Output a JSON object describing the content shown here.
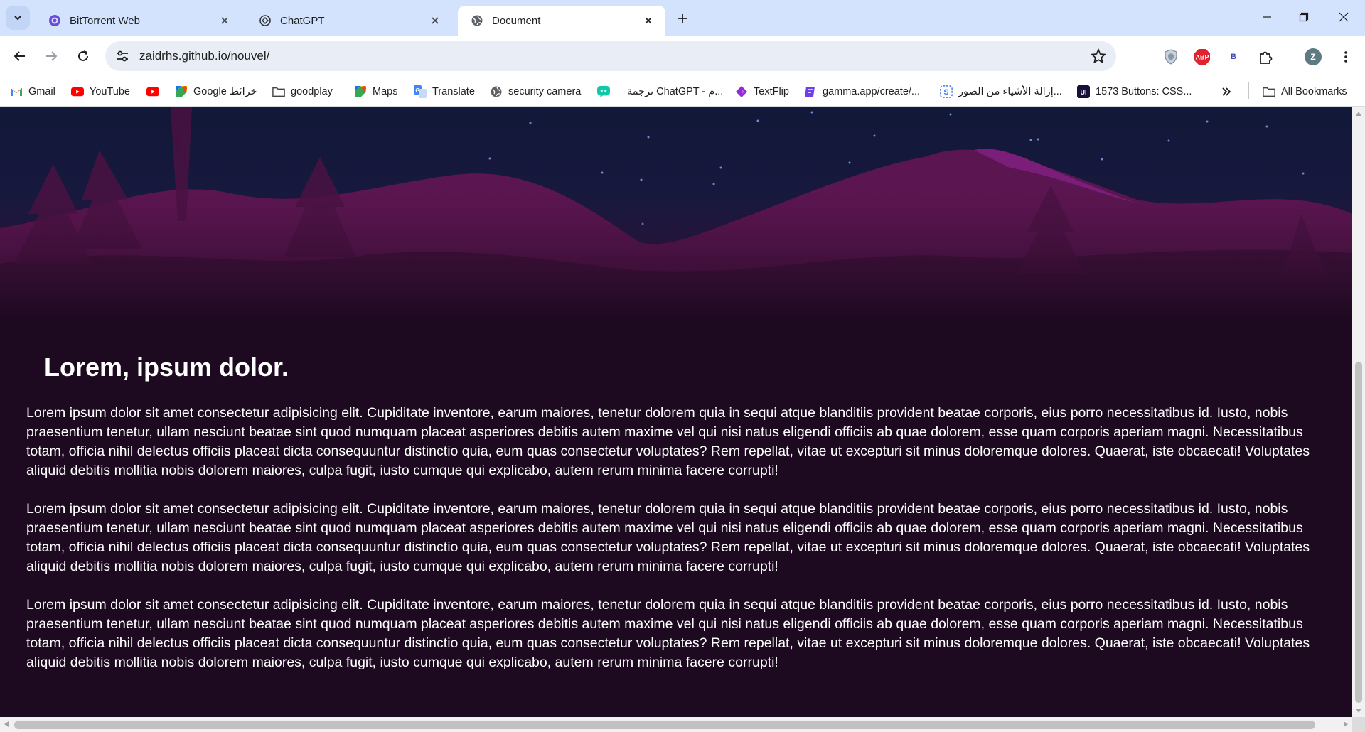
{
  "browser": {
    "tabs": [
      {
        "title": "BitTorrent Web",
        "active": false,
        "icon": "bittorrent-icon"
      },
      {
        "title": "ChatGPT",
        "active": false,
        "icon": "chatgpt-icon"
      },
      {
        "title": "Document",
        "active": true,
        "icon": "globe-icon"
      }
    ],
    "url": "zaidrhs.github.io/nouvel/",
    "profile_initial": "Z",
    "extensions": [
      "shield-extension-icon",
      "adblock-plus-icon",
      "b-extension-icon",
      "puzzle-extensions-icon"
    ],
    "adblock_label": "ABP",
    "b_ext_label": "B"
  },
  "bookmarks": [
    {
      "label": "Gmail",
      "icon": "gmail-icon"
    },
    {
      "label": "YouTube",
      "icon": "youtube-icon"
    },
    {
      "label": "",
      "icon": "youtube-icon"
    },
    {
      "label": "Google خرائط",
      "icon": "google-maps-icon"
    },
    {
      "label": "goodplay",
      "icon": "folder-icon"
    },
    {
      "label": "Maps",
      "icon": "google-maps-icon"
    },
    {
      "label": "Translate",
      "icon": "translate-icon"
    },
    {
      "label": "security camera",
      "icon": "globe-icon"
    },
    {
      "label": "ترجمة ChatGPT - م...",
      "icon": "chat-bubble-icon"
    },
    {
      "label": "TextFlip",
      "icon": "textflip-icon"
    },
    {
      "label": "gamma.app/create/...",
      "icon": "gamma-icon"
    },
    {
      "label": "إزالة الأشياء من الصور...",
      "icon": "s-app-icon"
    },
    {
      "label": "1573 Buttons: CSS...",
      "icon": "ui-icon"
    }
  ],
  "all_bookmarks_label": "All Bookmarks",
  "page": {
    "heading": "Lorem, ipsum dolor.",
    "paragraphs": [
      "Lorem ipsum dolor sit amet consectetur adipisicing elit. Cupiditate inventore, earum maiores, tenetur dolorem quia in sequi atque blanditiis provident beatae corporis, eius porro necessitatibus id. Iusto, nobis praesentium tenetur, ullam nesciunt beatae sint quod numquam placeat asperiores debitis autem maxime vel qui nisi natus eligendi officiis ab quae dolorem, esse quam corporis aperiam magni. Necessitatibus totam, officia nihil delectus officiis placeat dicta consequuntur distinctio quia, eum quas consectetur voluptates? Rem repellat, vitae ut excepturi sit minus doloremque dolores. Quaerat, iste obcaecati! Voluptates aliquid debitis mollitia nobis dolorem maiores, culpa fugit, iusto cumque qui explicabo, autem rerum minima facere corrupti!",
      "Lorem ipsum dolor sit amet consectetur adipisicing elit. Cupiditate inventore, earum maiores, tenetur dolorem quia in sequi atque blanditiis provident beatae corporis, eius porro necessitatibus id. Iusto, nobis praesentium tenetur, ullam nesciunt beatae sint quod numquam placeat asperiores debitis autem maxime vel qui nisi natus eligendi officiis ab quae dolorem, esse quam corporis aperiam magni. Necessitatibus totam, officia nihil delectus officiis placeat dicta consequuntur distinctio quia, eum quas consectetur voluptates? Rem repellat, vitae ut excepturi sit minus doloremque dolores. Quaerat, iste obcaecati! Voluptates aliquid debitis mollitia nobis dolorem maiores, culpa fugit, iusto cumque qui explicabo, autem rerum minima facere corrupti!",
      "Lorem ipsum dolor sit amet consectetur adipisicing elit. Cupiditate inventore, earum maiores, tenetur dolorem quia in sequi atque blanditiis provident beatae corporis, eius porro necessitatibus id. Iusto, nobis praesentium tenetur, ullam nesciunt beatae sint quod numquam placeat asperiores debitis autem maxime vel qui nisi natus eligendi officiis ab quae dolorem, esse quam corporis aperiam magni. Necessitatibus totam, officia nihil delectus officiis placeat dicta consequuntur distinctio quia, eum quas consectetur voluptates? Rem repellat, vitae ut excepturi sit minus doloremque dolores. Quaerat, iste obcaecati! Voluptates aliquid debitis mollitia nobis dolorem maiores, culpa fugit, iusto cumque qui explicabo, autem rerum minima facere corrupti!"
    ]
  },
  "colors": {
    "tabstrip": "#d3e3fd",
    "page_background": "#1d0920",
    "sky_top": "#121838",
    "mountain": "#5b1550",
    "mountain_highlight": "#6e1a6a"
  }
}
